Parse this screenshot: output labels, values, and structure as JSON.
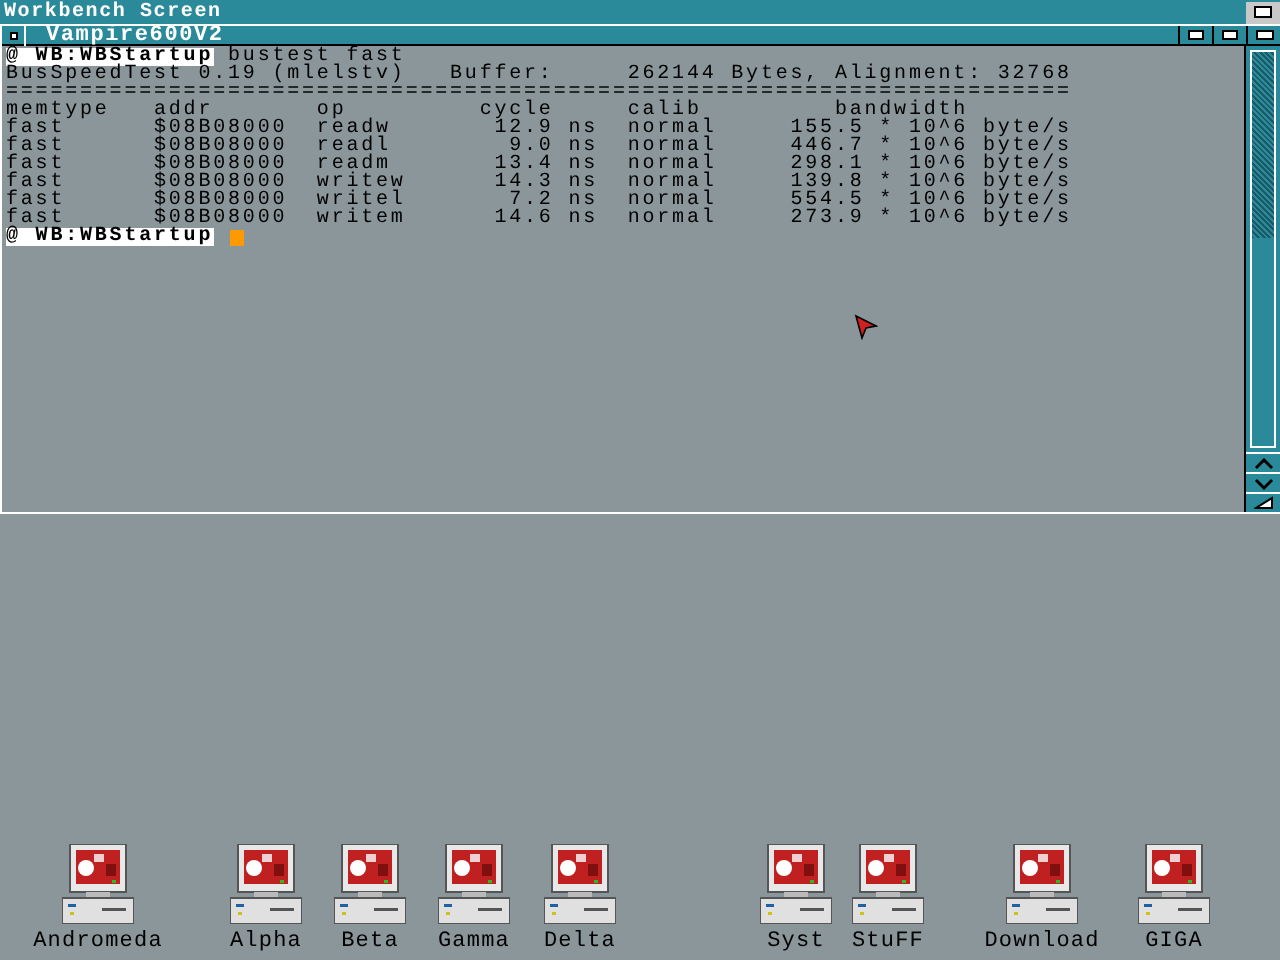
{
  "screen": {
    "title": "Workbench Screen"
  },
  "window": {
    "title": "Vampire600V2",
    "console": [
      {
        "kind": "prompt",
        "prompt": "@ WB:WBStartup",
        "text": " bustest fast"
      },
      {
        "kind": "output",
        "text": "BusSpeedTest 0.19 (mlelstv)   Buffer:     262144 Bytes, Alignment: 32768"
      },
      {
        "kind": "output",
        "text": "========================================================================"
      },
      {
        "kind": "output",
        "text": "memtype   addr       op         cycle     calib         bandwidth"
      },
      {
        "kind": "output",
        "text": "fast      $08B08000  readw       12.9 ns  normal     155.5 * 10^6 byte/s"
      },
      {
        "kind": "output",
        "text": "fast      $08B08000  readl        9.0 ns  normal     446.7 * 10^6 byte/s"
      },
      {
        "kind": "output",
        "text": "fast      $08B08000  readm       13.4 ns  normal     298.1 * 10^6 byte/s"
      },
      {
        "kind": "output",
        "text": "fast      $08B08000  writew      14.3 ns  normal     139.8 * 10^6 byte/s"
      },
      {
        "kind": "output",
        "text": "fast      $08B08000  writel       7.2 ns  normal     554.5 * 10^6 byte/s"
      },
      {
        "kind": "output",
        "text": "fast      $08B08000  writem      14.6 ns  normal     273.9 * 10^6 byte/s"
      },
      {
        "kind": "prompt",
        "prompt": "@ WB:WBStartup",
        "cursor": true
      }
    ]
  },
  "desktop_icons": [
    {
      "label": "Andromeda"
    },
    {
      "label": "Alpha"
    },
    {
      "label": "Beta"
    },
    {
      "label": "Gamma"
    },
    {
      "label": "Delta"
    },
    {
      "label": "Syst"
    },
    {
      "label": "StuFF"
    },
    {
      "label": "Download"
    },
    {
      "label": "GIGA"
    }
  ]
}
